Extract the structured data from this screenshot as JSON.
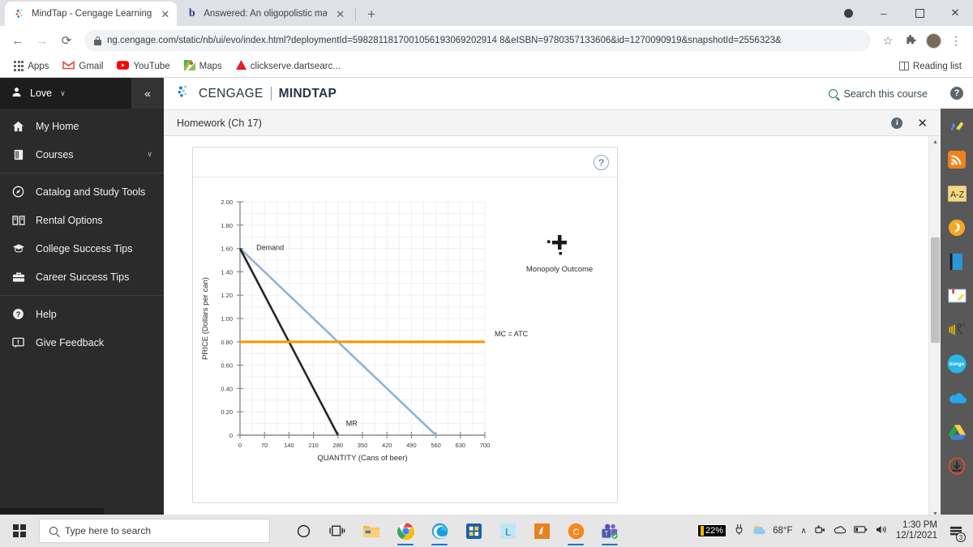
{
  "browser": {
    "tabs": [
      {
        "title": "MindTap - Cengage Learning",
        "favicon": "cengage-icon",
        "active": true,
        "close_label": "✕"
      },
      {
        "title": "Answered: An oligopolistic marke",
        "favicon": "bartleby-icon",
        "active": false,
        "close_label": "✕"
      }
    ],
    "new_tab_label": "+",
    "window_controls": {
      "record": "record-dot",
      "minimize": "–",
      "maximize": "❐",
      "close": "✕"
    },
    "nav": {
      "back": "←",
      "forward": "→",
      "reload": "⟳"
    },
    "url": "ng.cengage.com/static/nb/ui/evo/index.html?deploymentId=5982811817001056193069202914 8&eISBN=9780357133606&id=1270090919&snapshotId=2556323&",
    "omni_icons": {
      "bookmark": "☆",
      "extensions": "extensions-icon",
      "menu": "⋮"
    },
    "bookmarks": [
      {
        "label": "Apps",
        "icon": "apps-grid-icon"
      },
      {
        "label": "Gmail",
        "icon": "gmail-icon"
      },
      {
        "label": "YouTube",
        "icon": "youtube-icon"
      },
      {
        "label": "Maps",
        "icon": "maps-icon"
      },
      {
        "label": "clickserve.dartsearc...",
        "icon": "adobe-icon"
      }
    ],
    "reading_list": "Reading list"
  },
  "sidebar": {
    "user": {
      "name": "Love",
      "caret": "∨",
      "avatar_icon": "person-icon"
    },
    "collapse_label": "«",
    "items": [
      {
        "label": "My Home",
        "icon": "home-icon"
      },
      {
        "label": "Courses",
        "icon": "book-icon",
        "chevron": "∨"
      },
      {
        "label": "Catalog and Study Tools",
        "icon": "compass-icon"
      },
      {
        "label": "Rental Options",
        "icon": "open-book-icon"
      },
      {
        "label": "College Success Tips",
        "icon": "graduation-cap-icon"
      },
      {
        "label": "Career Success Tips",
        "icon": "briefcase-icon"
      },
      {
        "label": "Help",
        "icon": "question-circle-icon"
      },
      {
        "label": "Give Feedback",
        "icon": "feedback-icon"
      }
    ]
  },
  "header": {
    "brand_primary": "CENGAGE",
    "brand_secondary": "MINDTAP",
    "search_label": "Search this course",
    "assignment_title": "Homework (Ch 17)",
    "info_label": "i",
    "close_label": "✕"
  },
  "card": {
    "help_label": "?"
  },
  "rail": {
    "help_label": "?",
    "items": [
      {
        "name": "highlighter-pen-icon"
      },
      {
        "name": "rss-feed-icon"
      },
      {
        "name": "a-to-z-glossary-icon"
      },
      {
        "name": "flashcards-icon"
      },
      {
        "name": "ebook-icon"
      },
      {
        "name": "notes-icon"
      },
      {
        "name": "read-aloud-icon"
      },
      {
        "name": "bongo-icon",
        "label": "bongo"
      },
      {
        "name": "onedrive-icon"
      },
      {
        "name": "google-drive-icon"
      },
      {
        "name": "download-icon"
      }
    ]
  },
  "taskbar": {
    "search_placeholder": "Type here to search",
    "apps": [
      {
        "name": "cortana-icon"
      },
      {
        "name": "task-view-icon"
      },
      {
        "name": "file-explorer-icon"
      },
      {
        "name": "chrome-icon"
      },
      {
        "name": "edge-icon"
      },
      {
        "name": "microsoft-store-icon"
      },
      {
        "name": "lastpass-icon"
      },
      {
        "name": "mahjong-icon"
      },
      {
        "name": "chegg-icon"
      },
      {
        "name": "teams-icon"
      }
    ],
    "battery_percent": "22%",
    "weather_temp": "68°F",
    "tray_expand": "∧",
    "time": "1:30 PM",
    "date": "12/1/2021",
    "notification_count": "3"
  },
  "chart_data": {
    "type": "line",
    "title": "",
    "xlabel": "QUANTITY (Cans of beer)",
    "ylabel": "PRICE (Dollars per can)",
    "xlim": [
      0,
      700
    ],
    "ylim": [
      0,
      2.0
    ],
    "xticks": [
      0,
      70,
      140,
      210,
      280,
      350,
      420,
      490,
      560,
      630,
      700
    ],
    "yticks": [
      "0",
      "0.20",
      "0.40",
      "0.60",
      "0.80",
      "1.00",
      "1.20",
      "1.40",
      "1.60",
      "1.80",
      "2.00"
    ],
    "grid": true,
    "series": [
      {
        "name": "Demand",
        "color": "#8cb4dd",
        "label": "Demand",
        "points": [
          {
            "x": 0,
            "y": 1.6
          },
          {
            "x": 560,
            "y": 0
          }
        ]
      },
      {
        "name": "MR",
        "color": "#262626",
        "label": "MR",
        "points": [
          {
            "x": 0,
            "y": 1.6
          },
          {
            "x": 280,
            "y": 0
          }
        ]
      },
      {
        "name": "MC = ATC",
        "color": "#f59a06",
        "label": "MC = ATC",
        "points": [
          {
            "x": 0,
            "y": 0.8
          },
          {
            "x": 700,
            "y": 0.8
          }
        ]
      }
    ],
    "legend_position": "right",
    "annotations": [
      {
        "name": "Monopoly Outcome",
        "marker": "plus-crosshair",
        "label": "Monopoly Outcome"
      }
    ]
  }
}
